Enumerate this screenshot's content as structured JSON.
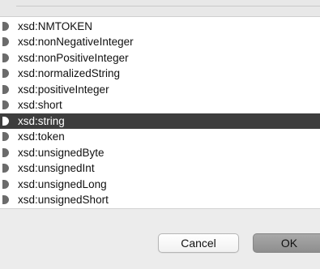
{
  "types": [
    {
      "label": "xsd:NMTOKEN",
      "selected": false
    },
    {
      "label": "xsd:nonNegativeInteger",
      "selected": false
    },
    {
      "label": "xsd:nonPositiveInteger",
      "selected": false
    },
    {
      "label": "xsd:normalizedString",
      "selected": false
    },
    {
      "label": "xsd:positiveInteger",
      "selected": false
    },
    {
      "label": "xsd:short",
      "selected": false
    },
    {
      "label": "xsd:string",
      "selected": true
    },
    {
      "label": "xsd:token",
      "selected": false
    },
    {
      "label": "xsd:unsignedByte",
      "selected": false
    },
    {
      "label": "xsd:unsignedInt",
      "selected": false
    },
    {
      "label": "xsd:unsignedLong",
      "selected": false
    },
    {
      "label": "xsd:unsignedShort",
      "selected": false
    }
  ],
  "buttons": {
    "cancel_label": "Cancel",
    "ok_label": "OK"
  },
  "colors": {
    "selection": "#3d3d3d",
    "icon": "#6b6b6b",
    "icon_selected": "#ffffff"
  }
}
